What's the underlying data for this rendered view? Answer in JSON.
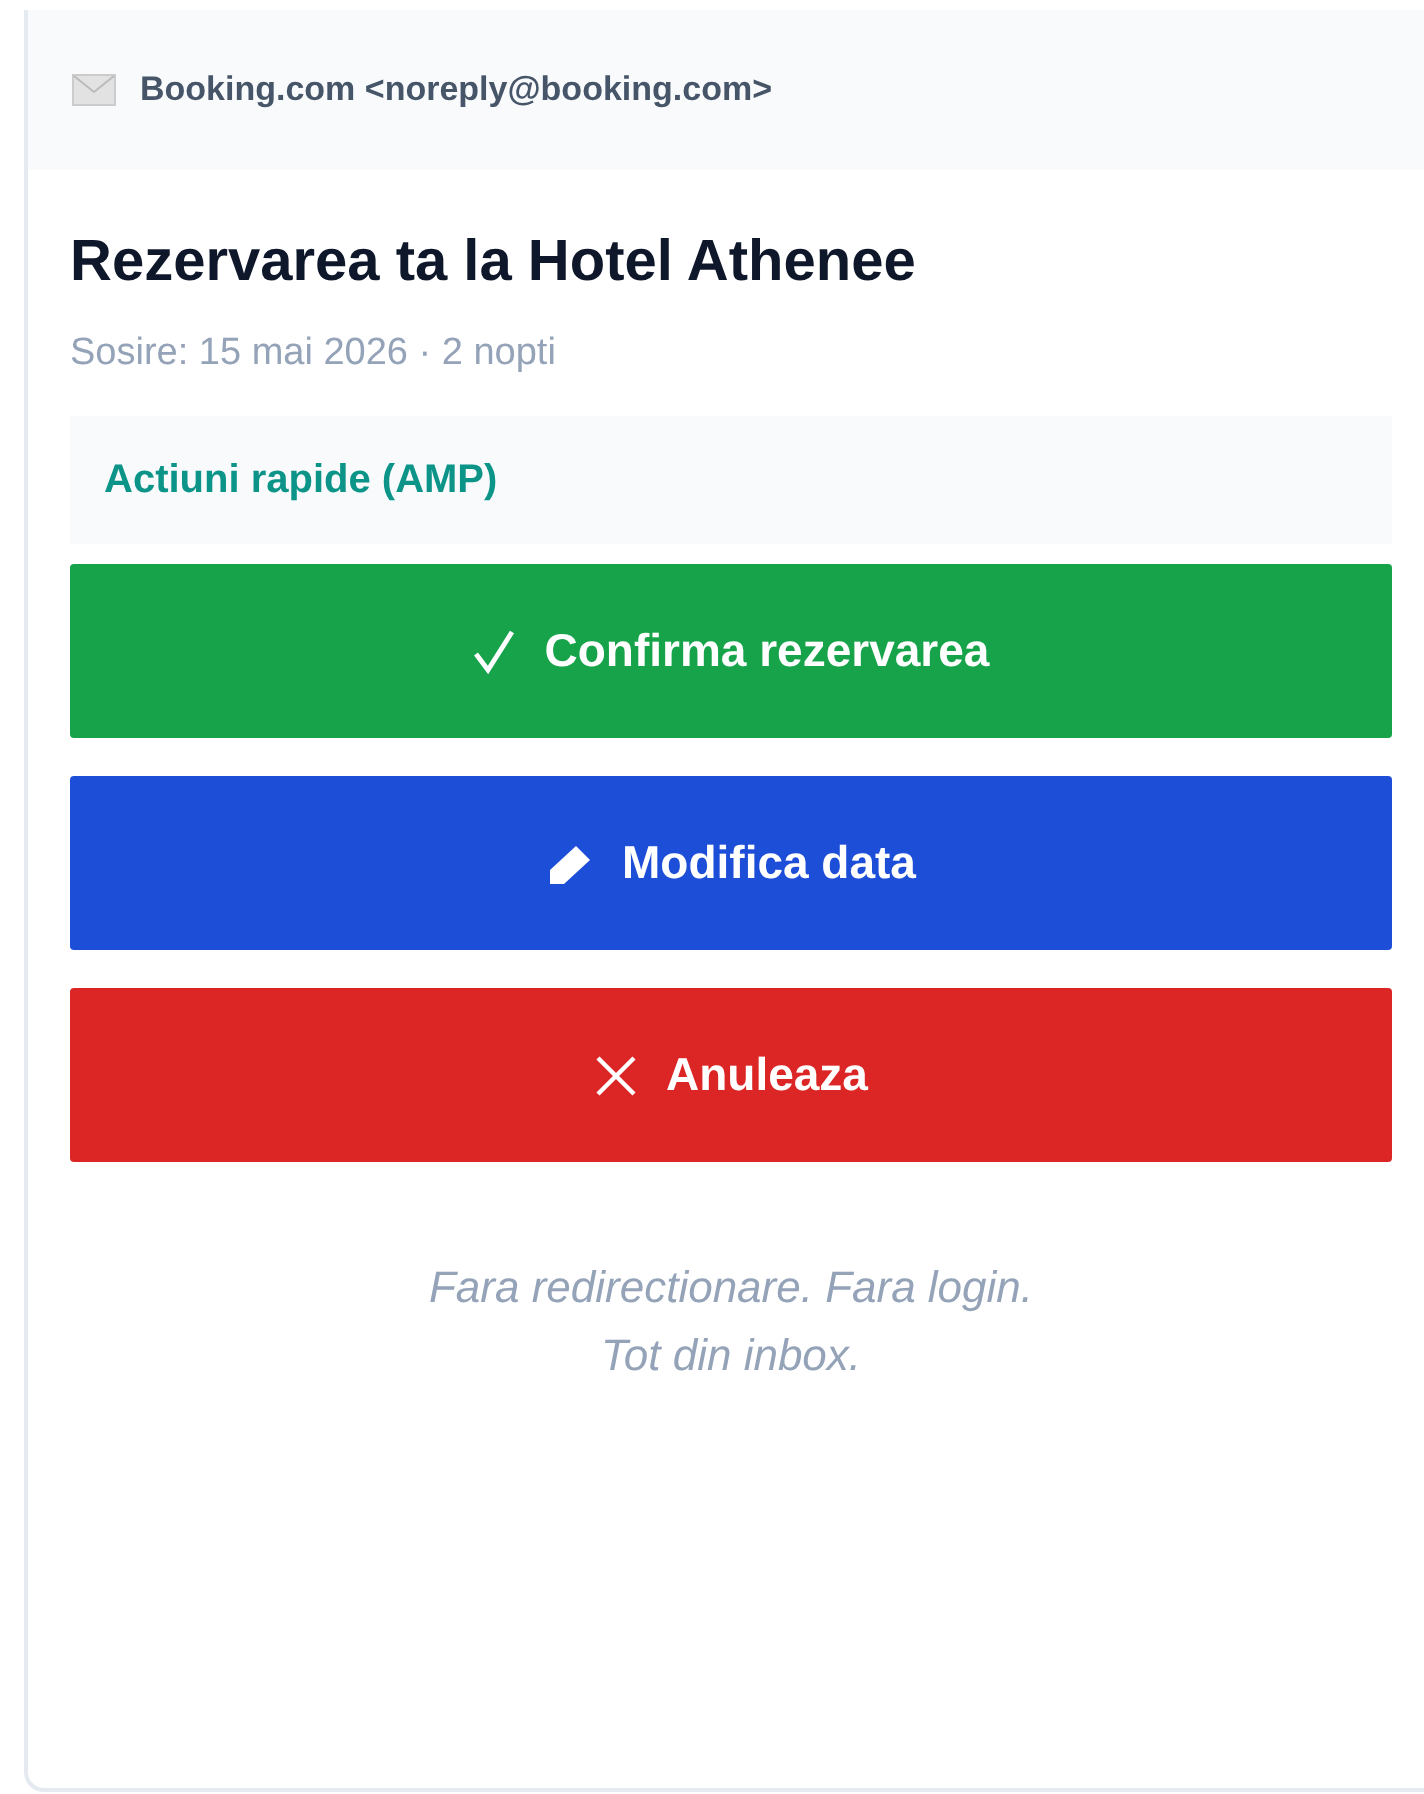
{
  "email": {
    "sender": "Booking.com <noreply@booking.com>",
    "subject": "Rezervarea ta la Hotel Athenee",
    "meta": "Sosire: 15 mai 2026 · 2 nopti"
  },
  "section": {
    "title": "Actiuni rapide (AMP)"
  },
  "buttons": [
    {
      "kind": "confirm",
      "label": "Confirma rezervarea"
    },
    {
      "kind": "edit",
      "label": "Modifica data"
    },
    {
      "kind": "cancel",
      "label": "Anuleaza"
    }
  ],
  "footer_lines": [
    "Fara redirectionare. Fara login.",
    "Tot din inbox."
  ]
}
